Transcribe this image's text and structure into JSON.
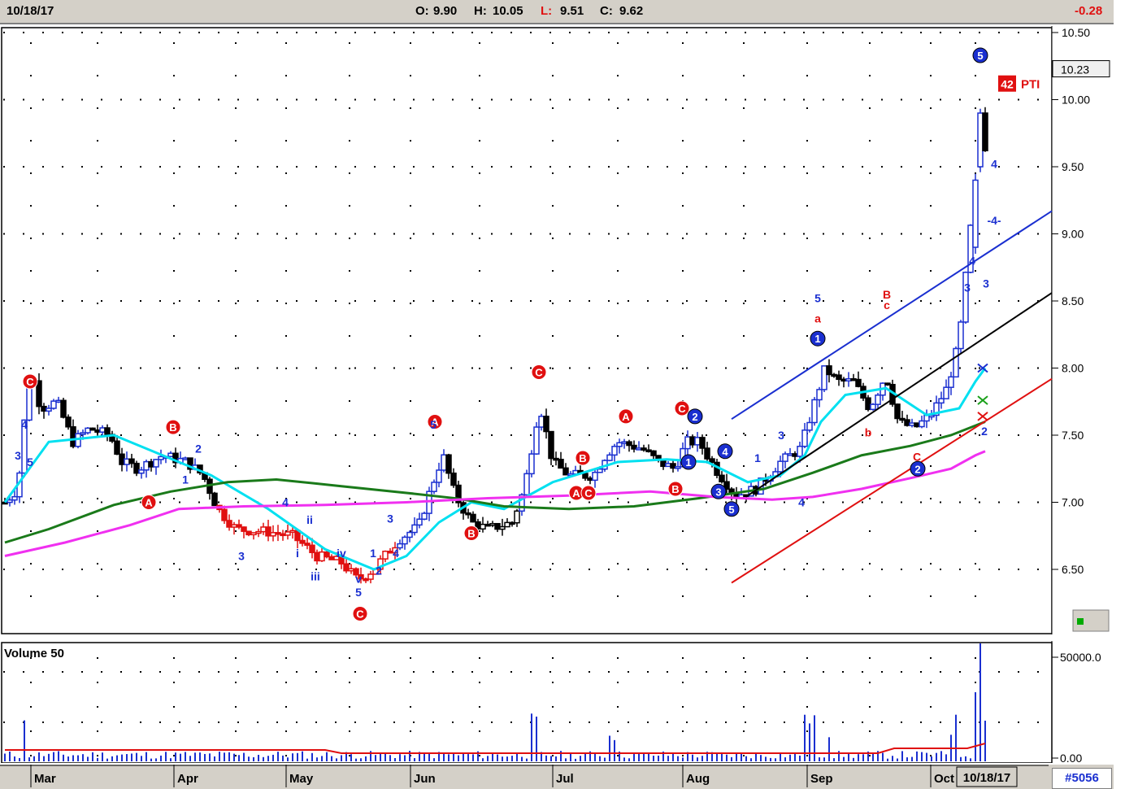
{
  "header": {
    "date": "10/18/17",
    "open_label": "O:",
    "open": "9.90",
    "high_label": "H:",
    "high": "10.05",
    "low_label": "L:",
    "low": "9.51",
    "close_label": "C:",
    "close": "9.62",
    "change": "-0.28"
  },
  "colors": {
    "up": "#1a2fd0",
    "down": "#000000",
    "red": "#e01010",
    "cyan": "#00e0f0",
    "green": "#1a7a1a",
    "magenta": "#f030f0"
  },
  "chart_data": {
    "type": "candlestick",
    "period": "daily",
    "price_axis": {
      "ticks": [
        "10.50",
        "10.00",
        "9.50",
        "9.00",
        "8.50",
        "8.00",
        "7.50",
        "7.00",
        "6.50"
      ],
      "ylim": [
        6.0,
        10.5
      ]
    },
    "last_price_label": "10.23",
    "indicator_badge": {
      "value": "42",
      "name": "PTI"
    },
    "month_labels": [
      "Mar",
      "Apr",
      "May",
      "Jun",
      "Jul",
      "Aug",
      "Sep",
      "Oct"
    ],
    "current_date_label": "10/18/17",
    "series": [
      {
        "name": "close_approx",
        "dates_by_month_idx": [
          0,
          0.5,
          1,
          1.5,
          2,
          2.5,
          3,
          3.5,
          4,
          4.5,
          5,
          5.5,
          6,
          6.5,
          7,
          7.2
        ],
        "values": [
          7.0,
          7.8,
          7.4,
          7.3,
          6.8,
          6.75,
          6.5,
          6.9,
          6.8,
          7.3,
          7.2,
          7.4,
          7.3,
          8.1,
          7.5,
          9.62
        ]
      }
    ],
    "volume": {
      "label": "Volume 50",
      "axis_ticks": [
        "50000.0",
        "0.00"
      ]
    },
    "wave_labels": [
      "C",
      "5",
      "3",
      "4",
      "B",
      "A",
      "1",
      "2",
      "3",
      "4",
      "ii",
      "iii",
      "i",
      "iv",
      "v",
      "5",
      "C",
      "3",
      "4",
      "1",
      "2",
      "A",
      "5",
      "B",
      "C",
      "A",
      "B",
      "A",
      "C",
      "C",
      "B",
      "2",
      "1",
      "4",
      "3",
      "5",
      "1",
      "2",
      "3",
      "4",
      "1",
      "5",
      "a",
      "B",
      "c",
      "b",
      "C",
      "2",
      "3",
      "4",
      "4",
      "5",
      "3",
      "-4-"
    ]
  },
  "footer": {
    "symbol": "#5056"
  }
}
